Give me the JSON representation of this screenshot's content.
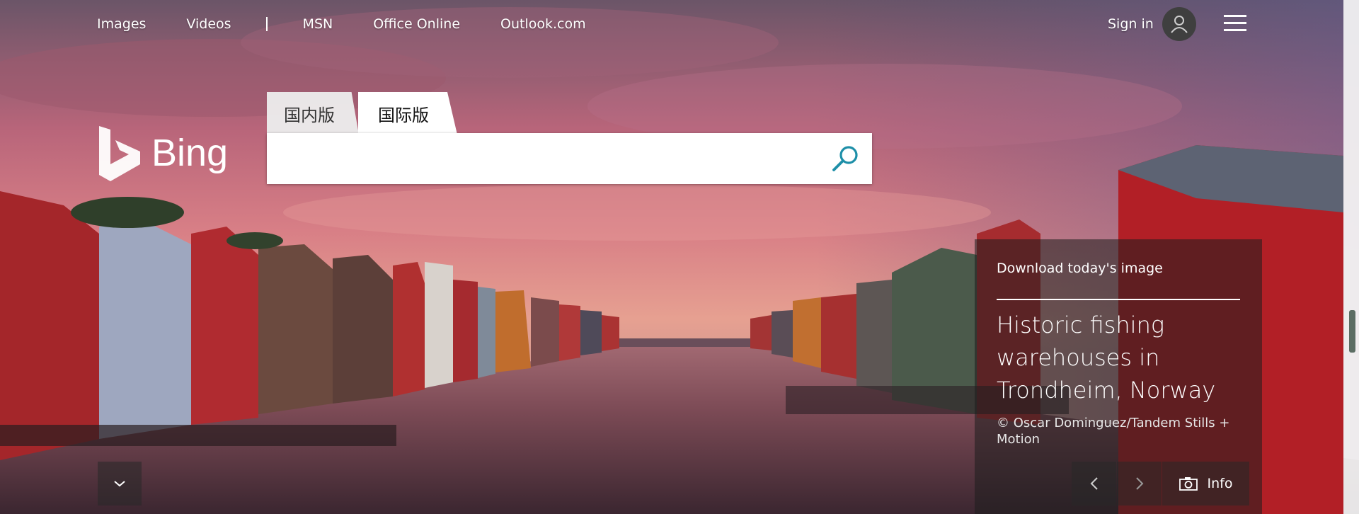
{
  "topnav": {
    "links": [
      "Images",
      "Videos",
      "MSN",
      "Office Online",
      "Outlook.com"
    ]
  },
  "account": {
    "sign_in_label": "Sign in"
  },
  "logo": {
    "text": "Bing"
  },
  "search": {
    "tabs": [
      "国内版",
      "国际版"
    ],
    "active_tab": "国际版",
    "query": "",
    "placeholder": ""
  },
  "image_info": {
    "download_label": "Download today's image",
    "headline": "Historic fishing warehouses in Trondheim, Norway",
    "copyright": "© Oscar Dominguez/Tandem Stills + Motion",
    "info_label": "Info"
  },
  "icons": {
    "menu": "hamburger-icon",
    "avatar": "user-icon",
    "search": "search-icon",
    "prev": "chevron-left-icon",
    "next": "chevron-right-icon",
    "camera": "camera-icon",
    "scroll": "chevron-down-icon"
  },
  "colors": {
    "search_icon": "#1e8fa8",
    "panel_bg": "#1e1e1e"
  }
}
